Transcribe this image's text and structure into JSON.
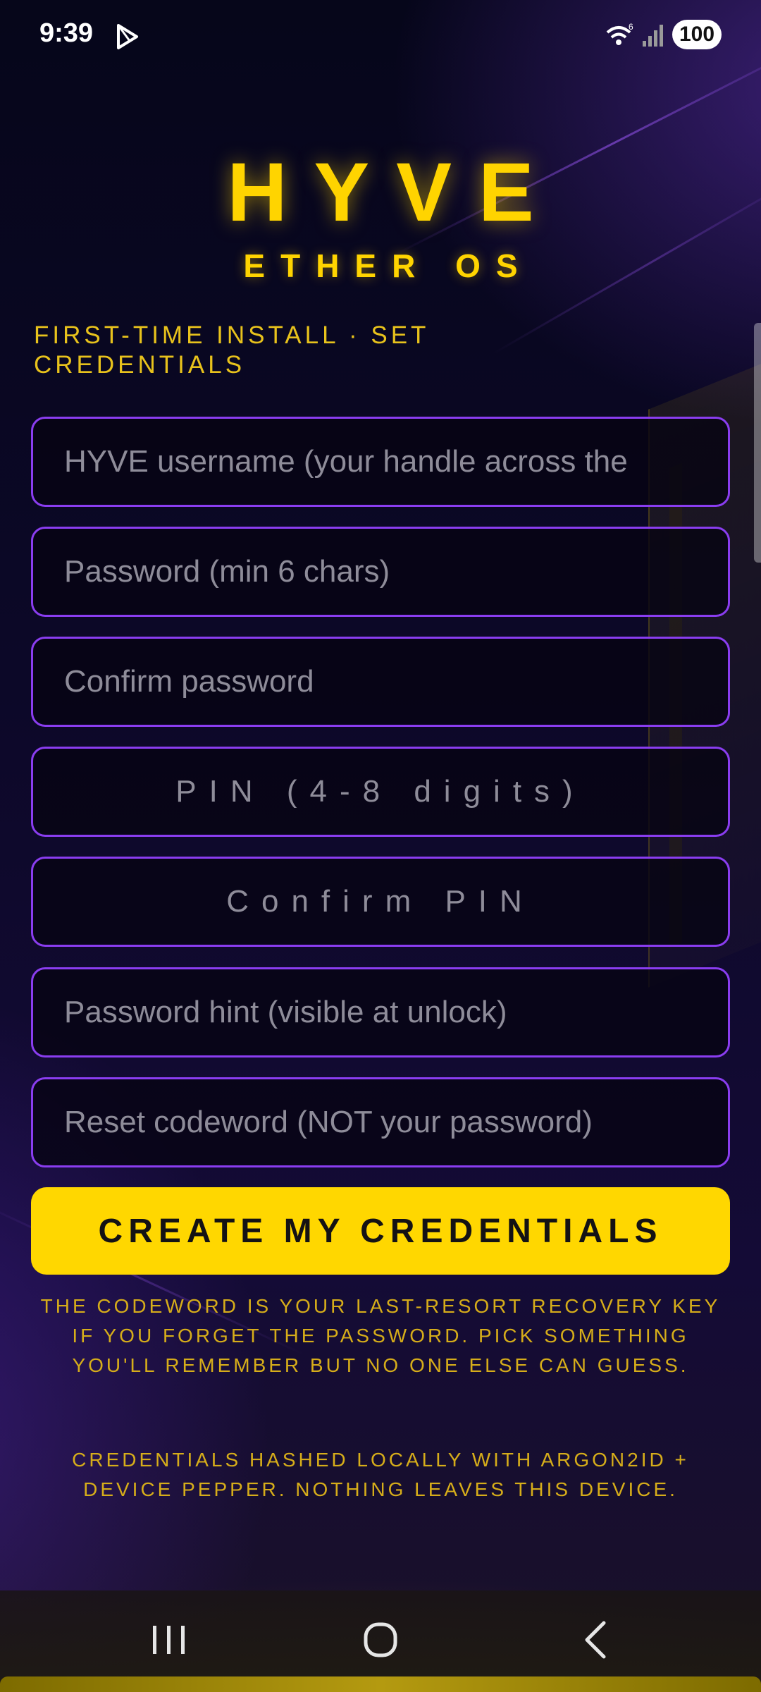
{
  "status_bar": {
    "time": "9:39",
    "battery": "100",
    "icons": [
      "play-store-icon",
      "wifi-icon",
      "signal-icon"
    ]
  },
  "header": {
    "title": "HYVE",
    "subtitle": "ETHER OS",
    "section_heading": "FIRST-TIME INSTALL · SET CREDENTIALS"
  },
  "form": {
    "username_placeholder": "HYVE username (your handle across the",
    "password_placeholder": "Password (min 6 chars)",
    "confirm_password_placeholder": "Confirm password",
    "pin_placeholder": "PIN (4-8 digits)",
    "confirm_pin_placeholder": "Confirm PIN",
    "hint_placeholder": "Password hint (visible at unlock)",
    "codeword_placeholder": "Reset codeword (NOT your password)",
    "submit_label": "CREATE MY CREDENTIALS"
  },
  "notes": {
    "codeword_note": "THE CODEWORD IS YOUR LAST-RESORT RECOVERY KEY IF YOU FORGET THE PASSWORD. PICK SOMETHING YOU'LL REMEMBER BUT NO ONE ELSE CAN GUESS.",
    "security_note": "CREDENTIALS HASHED LOCALLY WITH ARGON2ID + DEVICE PEPPER. NOTHING LEAVES THIS DEVICE."
  },
  "colors": {
    "accent": "#ffd700",
    "field_border": "#8a3df0",
    "background": "#0c0828"
  },
  "nav_bar": {
    "icons": [
      "recents-icon",
      "home-icon",
      "back-icon"
    ]
  }
}
